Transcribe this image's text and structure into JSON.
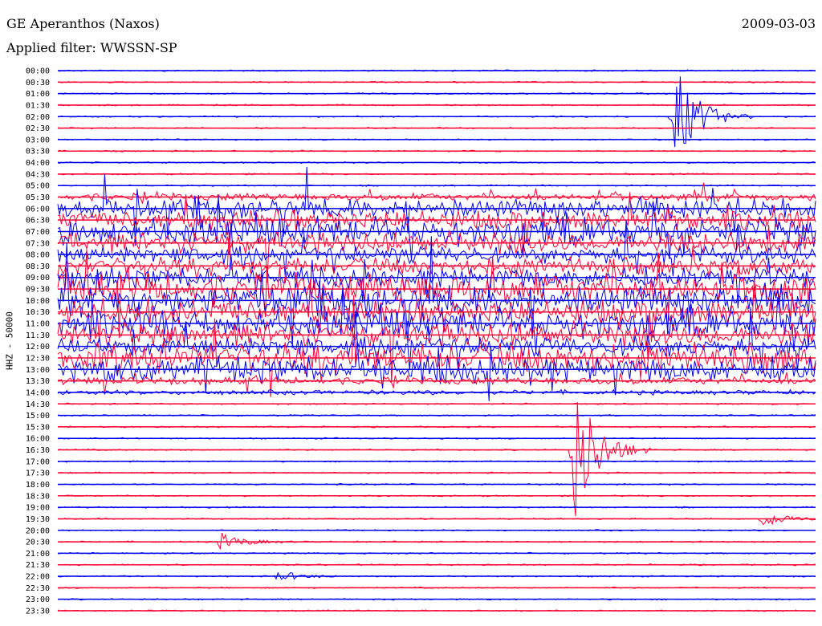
{
  "header": {
    "station": "GE Aperanthos (Naxos)",
    "filter": "Applied filter: WWSSN-SP",
    "date": "2009-03-03"
  },
  "colors": {
    "even_trace": "#0000ee",
    "odd_trace": "#ff0033",
    "background": "#ffffff"
  },
  "chart_data": {
    "type": "line",
    "ylabel": "HHZ - 50000",
    "row_labels": [
      "00:00",
      "00:30",
      "01:00",
      "01:30",
      "02:00",
      "02:30",
      "03:00",
      "03:30",
      "04:00",
      "04:30",
      "05:00",
      "05:30",
      "06:00",
      "06:30",
      "07:00",
      "07:30",
      "08:00",
      "08:30",
      "09:00",
      "09:30",
      "10:00",
      "10:30",
      "11:00",
      "11:30",
      "12:00",
      "12:30",
      "13:00",
      "13:30",
      "14:00",
      "14:30",
      "15:00",
      "15:30",
      "16:00",
      "16:30",
      "17:00",
      "17:30",
      "18:00",
      "18:30",
      "19:00",
      "19:30",
      "20:00",
      "20:30",
      "21:00",
      "21:30",
      "22:00",
      "22:30",
      "23:00",
      "23:30"
    ],
    "events": [
      {
        "row": "02:00",
        "minute": 24.5,
        "amplitude": 6
      },
      {
        "row": "16:30",
        "minute": 20.5,
        "amplitude": 9
      },
      {
        "row": "20:30",
        "minute": 6.5,
        "amplitude": 1
      },
      {
        "row": "19:30",
        "minute": 28,
        "amplitude": 1
      },
      {
        "row": "22:00",
        "minute": 8.8,
        "amplitude": 0.6
      }
    ],
    "noisy_rows": [
      "06:00",
      "13:00"
    ]
  }
}
